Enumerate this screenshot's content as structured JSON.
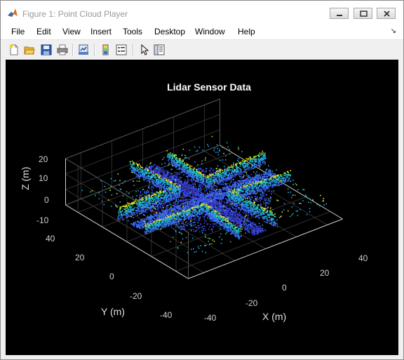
{
  "window": {
    "title": "Figure 1: Point Cloud Player",
    "controls": [
      "minimize-icon",
      "maximize-icon",
      "close-icon"
    ]
  },
  "menu": {
    "items": [
      "File",
      "Edit",
      "View",
      "Insert",
      "Tools",
      "Desktop",
      "Window",
      "Help"
    ],
    "dock_glyph": "↘"
  },
  "toolbar": {
    "buttons": [
      "new-figure-icon",
      "open-file-icon",
      "save-icon",
      "print-icon",
      "link-plot-icon",
      "colorbar-icon",
      "legend-icon",
      "pointer-icon",
      "property-inspector-icon"
    ]
  },
  "plot": {
    "title": "Lidar Sensor Data",
    "background": "#000000",
    "grid": true,
    "colormap": "parula (blue–cyan–yellow by height)",
    "x_axis": {
      "label": "X (m)",
      "ticks": [
        "-40",
        "-20",
        "0",
        "20",
        "40"
      ]
    },
    "y_axis": {
      "label": "Y (m)",
      "ticks": [
        "40",
        "20",
        "0",
        "-20",
        "-40"
      ]
    },
    "z_axis": {
      "label": "Z (m)",
      "ticks": [
        "20",
        "10",
        "0",
        "-10"
      ]
    }
  },
  "chart_data": {
    "type": "scatter",
    "title": "Lidar Sensor Data",
    "xlabel": "X (m)",
    "ylabel": "Y (m)",
    "zlabel": "Z (m)",
    "xlim": [
      -50,
      50
    ],
    "ylim": [
      -50,
      50
    ],
    "zlim": [
      -10,
      20
    ],
    "xticks": [
      -40,
      -20,
      0,
      20,
      40
    ],
    "yticks": [
      -40,
      -20,
      0,
      20,
      40
    ],
    "zticks": [
      -10,
      0,
      10,
      20
    ],
    "grid": true,
    "colors": [
      "#3a3fd8",
      "#3d66f0",
      "#24a5e3",
      "#18c4b4",
      "#e3e31a"
    ]
  }
}
